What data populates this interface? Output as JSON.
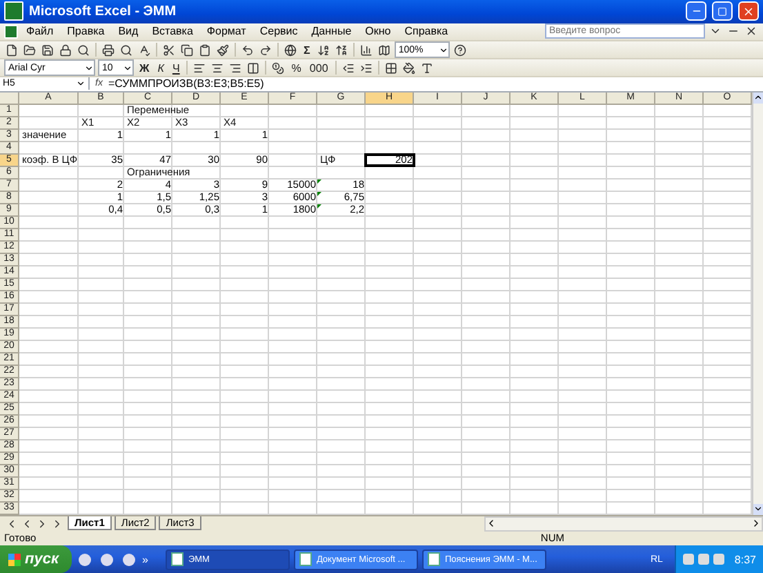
{
  "window": {
    "title": "Microsoft Excel - ЭММ"
  },
  "menu": [
    "Файл",
    "Правка",
    "Вид",
    "Вставка",
    "Формат",
    "Сервис",
    "Данные",
    "Окно",
    "Справка"
  ],
  "help_box": {
    "placeholder": "Введите вопрос"
  },
  "standard_toolbar": {
    "sum": "Σ",
    "zoom": "100%"
  },
  "format_toolbar": {
    "font": "Arial Cyr",
    "size": "10",
    "style_buttons": [
      "Ж",
      "К",
      "Ч"
    ],
    "number_buttons": [
      "%",
      "000"
    ]
  },
  "formula_bar": {
    "name_box": "H5",
    "fx": "fx",
    "formula": "=СУММПРОИЗВ(B3:E3;B5:E5)"
  },
  "columns": [
    {
      "label": "A",
      "selected": false
    },
    {
      "label": "B",
      "selected": false
    },
    {
      "label": "C",
      "selected": false
    },
    {
      "label": "D",
      "selected": false
    },
    {
      "label": "E",
      "selected": false
    },
    {
      "label": "F",
      "selected": false
    },
    {
      "label": "G",
      "selected": false
    },
    {
      "label": "H",
      "selected": true
    },
    {
      "label": "I",
      "selected": false
    },
    {
      "label": "J",
      "selected": false
    },
    {
      "label": "K",
      "selected": false
    },
    {
      "label": "L",
      "selected": false
    },
    {
      "label": "M",
      "selected": false
    },
    {
      "label": "N",
      "selected": false
    },
    {
      "label": "O",
      "selected": false
    }
  ],
  "rows": [
    {
      "number": "1",
      "selected": false,
      "cells": {
        "C": {
          "text": "Переменные",
          "kind": "text",
          "selected": false,
          "flag": false
        }
      }
    },
    {
      "number": "2",
      "selected": false,
      "cells": {
        "B": {
          "text": "X1",
          "kind": "text",
          "selected": false,
          "flag": false
        },
        "C": {
          "text": "X2",
          "kind": "text",
          "selected": false,
          "flag": false
        },
        "D": {
          "text": "X3",
          "kind": "text",
          "selected": false,
          "flag": false
        },
        "E": {
          "text": "X4",
          "kind": "text",
          "selected": false,
          "flag": false
        }
      }
    },
    {
      "number": "3",
      "selected": false,
      "cells": {
        "A": {
          "text": "значение",
          "kind": "text",
          "selected": false,
          "flag": false
        },
        "B": {
          "text": "1",
          "kind": "number",
          "selected": false,
          "flag": false
        },
        "C": {
          "text": "1",
          "kind": "number",
          "selected": false,
          "flag": false
        },
        "D": {
          "text": "1",
          "kind": "number",
          "selected": false,
          "flag": false
        },
        "E": {
          "text": "1",
          "kind": "number",
          "selected": false,
          "flag": false
        }
      }
    },
    {
      "number": "4",
      "selected": false
    },
    {
      "number": "5",
      "selected": true,
      "cells": {
        "A": {
          "text": "коэф. В ЦФ",
          "kind": "text",
          "selected": false,
          "flag": false
        },
        "B": {
          "text": "35",
          "kind": "number",
          "selected": false,
          "flag": false
        },
        "C": {
          "text": "47",
          "kind": "number",
          "selected": false,
          "flag": false
        },
        "D": {
          "text": "30",
          "kind": "number",
          "selected": false,
          "flag": false
        },
        "E": {
          "text": "90",
          "kind": "number",
          "selected": false,
          "flag": false
        },
        "G": {
          "text": "ЦФ",
          "kind": "text",
          "selected": false,
          "flag": false
        },
        "H": {
          "text": "202",
          "kind": "number",
          "selected": true,
          "flag": false
        }
      }
    },
    {
      "number": "6",
      "selected": false,
      "cells": {
        "C": {
          "text": "Ограничения",
          "kind": "text",
          "selected": false,
          "flag": false
        }
      }
    },
    {
      "number": "7",
      "selected": false,
      "cells": {
        "B": {
          "text": "2",
          "kind": "number",
          "selected": false,
          "flag": false
        },
        "C": {
          "text": "4",
          "kind": "number",
          "selected": false,
          "flag": false
        },
        "D": {
          "text": "3",
          "kind": "number",
          "selected": false,
          "flag": false
        },
        "E": {
          "text": "9",
          "kind": "number",
          "selected": false,
          "flag": false
        },
        "F": {
          "text": "15000",
          "kind": "number",
          "selected": false,
          "flag": false
        },
        "G": {
          "text": "18",
          "kind": "number",
          "selected": false,
          "flag": true
        }
      }
    },
    {
      "number": "8",
      "selected": false,
      "cells": {
        "B": {
          "text": "1",
          "kind": "number",
          "selected": false,
          "flag": false
        },
        "C": {
          "text": "1,5",
          "kind": "number",
          "selected": false,
          "flag": false
        },
        "D": {
          "text": "1,25",
          "kind": "number",
          "selected": false,
          "flag": false
        },
        "E": {
          "text": "3",
          "kind": "number",
          "selected": false,
          "flag": false
        },
        "F": {
          "text": "6000",
          "kind": "number",
          "selected": false,
          "flag": false
        },
        "G": {
          "text": "6,75",
          "kind": "number",
          "selected": false,
          "flag": true
        }
      }
    },
    {
      "number": "9",
      "selected": false,
      "cells": {
        "B": {
          "text": "0,4",
          "kind": "number",
          "selected": false,
          "flag": false
        },
        "C": {
          "text": "0,5",
          "kind": "number",
          "selected": false,
          "flag": false
        },
        "D": {
          "text": "0,3",
          "kind": "number",
          "selected": false,
          "flag": false
        },
        "E": {
          "text": "1",
          "kind": "number",
          "selected": false,
          "flag": false
        },
        "F": {
          "text": "1800",
          "kind": "number",
          "selected": false,
          "flag": false
        },
        "G": {
          "text": "2,2",
          "kind": "number",
          "selected": false,
          "flag": true
        }
      }
    },
    {
      "number": "10",
      "selected": false
    },
    {
      "number": "11",
      "selected": false
    },
    {
      "number": "12",
      "selected": false
    },
    {
      "number": "13",
      "selected": false
    },
    {
      "number": "14",
      "selected": false
    },
    {
      "number": "15",
      "selected": false
    },
    {
      "number": "16",
      "selected": false
    },
    {
      "number": "17",
      "selected": false
    },
    {
      "number": "18",
      "selected": false
    },
    {
      "number": "19",
      "selected": false
    },
    {
      "number": "20",
      "selected": false
    },
    {
      "number": "21",
      "selected": false
    },
    {
      "number": "22",
      "selected": false
    },
    {
      "number": "23",
      "selected": false
    },
    {
      "number": "24",
      "selected": false
    },
    {
      "number": "25",
      "selected": false
    },
    {
      "number": "26",
      "selected": false
    },
    {
      "number": "27",
      "selected": false
    },
    {
      "number": "28",
      "selected": false
    },
    {
      "number": "29",
      "selected": false
    },
    {
      "number": "30",
      "selected": false
    },
    {
      "number": "31",
      "selected": false
    },
    {
      "number": "32",
      "selected": false
    },
    {
      "number": "33",
      "selected": false
    }
  ],
  "sheet_tabs": [
    {
      "label": "Лист1",
      "selected": true
    },
    {
      "label": "Лист2",
      "selected": false
    },
    {
      "label": "Лист3",
      "selected": false
    }
  ],
  "status_bar": {
    "status": "Готово",
    "num": "NUM"
  },
  "taskbar": {
    "start": "пуск",
    "chevron": "»",
    "tasks": [
      {
        "label": "ЭММ",
        "selected": true
      },
      {
        "label": "Документ Microsoft ...",
        "selected": false
      },
      {
        "label": "Пояснения ЭММ - M...",
        "selected": false
      }
    ],
    "language": "RL",
    "time": "8:37"
  }
}
